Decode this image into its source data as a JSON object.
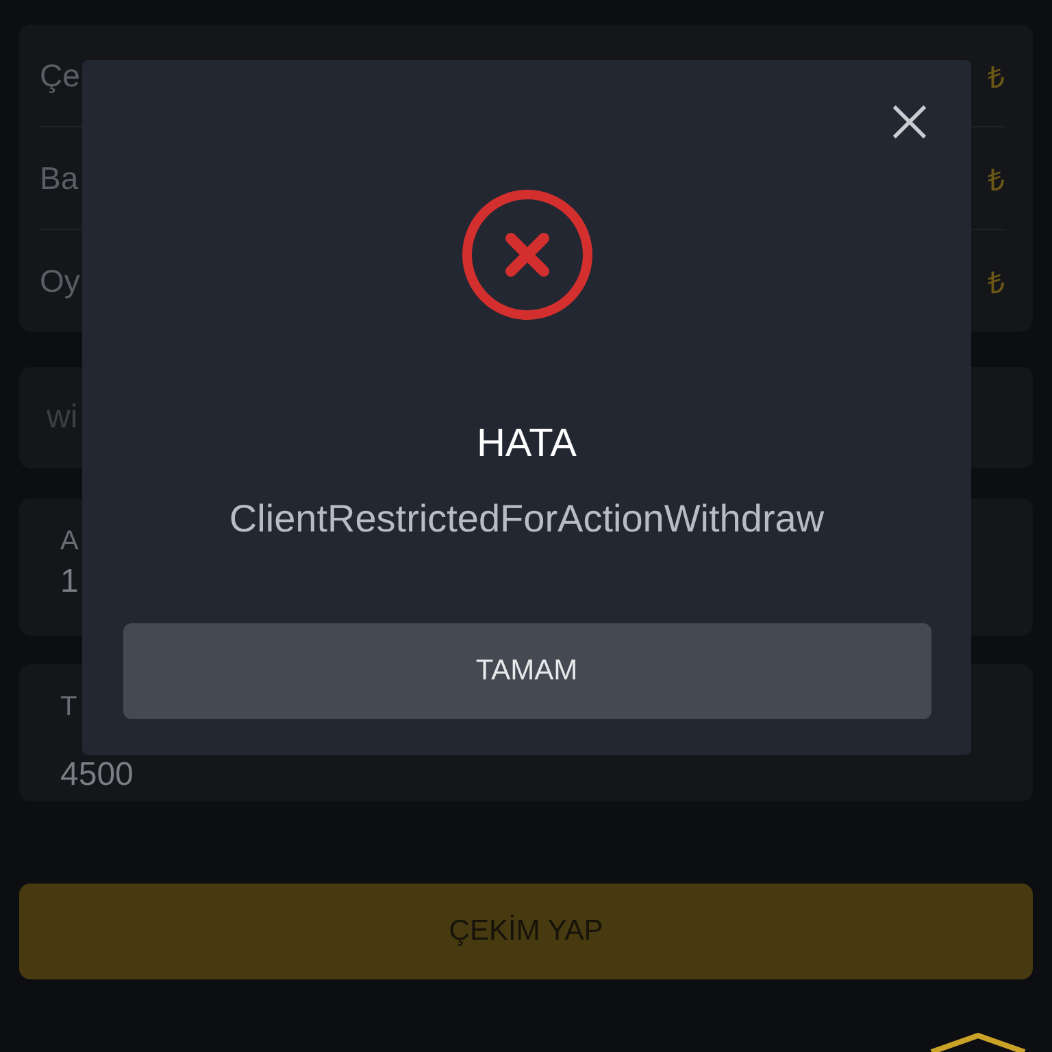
{
  "summary_rows": [
    {
      "label": "Çe",
      "value": "₺"
    },
    {
      "label": "Ba",
      "value": "₺"
    },
    {
      "label": "Oy",
      "value": "₺"
    }
  ],
  "method_field": {
    "value": "wi"
  },
  "fields": [
    {
      "label": "A",
      "value": "1"
    },
    {
      "label": "T",
      "value": "4500"
    }
  ],
  "submit_button": "ÇEKİM YAP",
  "dialog": {
    "title": "HATA",
    "message": "ClientRestrictedForActionWithdraw",
    "button": "TAMAM",
    "kind": "error"
  }
}
